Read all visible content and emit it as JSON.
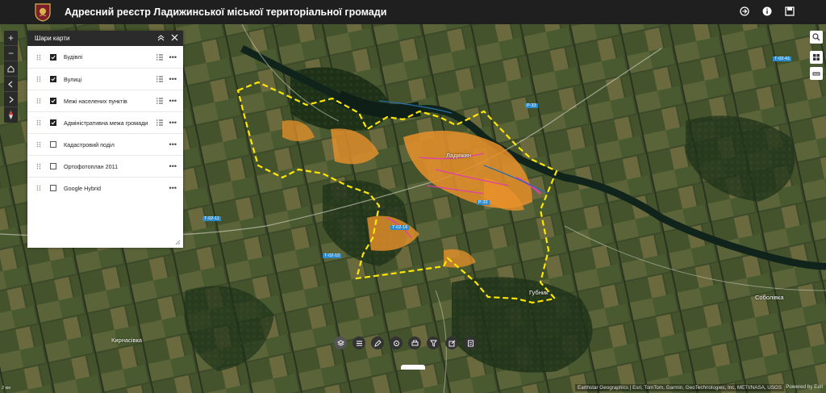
{
  "header": {
    "title": "Адресний реєстр Ладижинської міської територіальної громади",
    "actions": [
      "share-icon",
      "info-icon",
      "save-icon"
    ]
  },
  "map_tools": [
    "zoom-in-icon",
    "zoom-out-icon",
    "home-icon",
    "prev-extent-icon",
    "next-extent-icon",
    "compass-icon"
  ],
  "layers_panel": {
    "title": "Шари карти",
    "layers": [
      {
        "label": "Будівлі",
        "checked": true,
        "legend": true
      },
      {
        "label": "Вулиці",
        "checked": true,
        "legend": true
      },
      {
        "label": "Межі населених пунктів",
        "checked": true,
        "legend": true
      },
      {
        "label": "Адміністративна межа громади",
        "checked": true,
        "legend": true
      },
      {
        "label": "Кадастровий поділ",
        "checked": false,
        "legend": false
      },
      {
        "label": "Ортофотоплан 2011",
        "checked": false,
        "legend": false
      },
      {
        "label": "Google Hybrid",
        "checked": false,
        "legend": false
      }
    ]
  },
  "right_tools": [
    "search-icon",
    "basemap-gallery-icon",
    "measure-icon"
  ],
  "bottom_toolbar": [
    "layers-icon",
    "legend-icon",
    "draw-icon",
    "coordinates-icon",
    "print-icon",
    "filter-icon",
    "edit-icon",
    "print-page-icon"
  ],
  "place_labels": {
    "ladyzhyn": "Ладижин",
    "kyrnasivka": "Кирнасівка",
    "sobolivka": "Соболівка",
    "hubnyk": "Губник"
  },
  "road_shields": {
    "r": "Р-33",
    "t1": "Т-02-41",
    "t2": "Т-02-11",
    "t3": "Т-02-10",
    "r2": "Р-33",
    "t4": "Т-02-16"
  },
  "attribution": "Earthstar Geographics | Esri, TomTom, Garmin, GeoTechnologies, Inc, METI/NASA, USGS",
  "powered_by": "Powered by Esri",
  "scale_text": "2 км",
  "colors": {
    "header_bg": "#1f1f1f",
    "boundary": "#ffe600",
    "buildings": "#e8912a",
    "streets": "#e03fa8",
    "water": "#2a6ea8"
  }
}
